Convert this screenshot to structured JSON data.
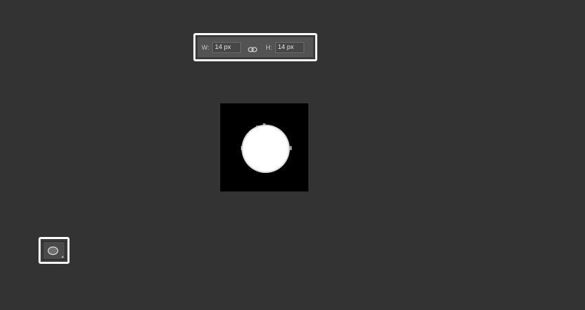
{
  "options_bar": {
    "width_label": "W:",
    "width_value": "14 px",
    "link_icon": "link-chain-icon",
    "height_label": "H:",
    "height_value": "14 px"
  },
  "canvas": {
    "background_color": "#000000",
    "shape": "ellipse",
    "shape_color": "#ffffff"
  },
  "toolbar": {
    "active_tool_icon": "ellipse-tool-icon",
    "has_submenu_indicator": true
  },
  "colors": {
    "workspace_bg": "#333333",
    "highlight_border": "#ffffff",
    "panel_bg": "#535353"
  }
}
